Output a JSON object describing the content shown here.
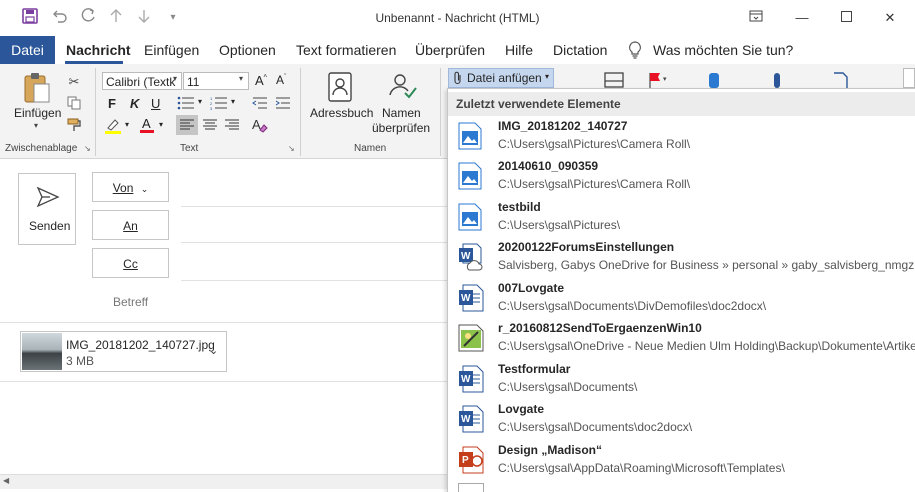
{
  "title_bar": {
    "title": "Unbenannt  -  Nachricht (HTML)",
    "save_icon": "save-icon",
    "undo_icon": "undo-icon",
    "redo_icon": "redo-icon",
    "up_icon": "up-arrow-icon",
    "down_icon": "down-arrow-icon",
    "customize_icon": "customize-icon"
  },
  "menu": {
    "datei": "Datei",
    "nachricht": "Nachricht",
    "einfuegen": "Einfügen",
    "optionen": "Optionen",
    "text_formatieren": "Text formatieren",
    "ueberpruefen": "Überprüfen",
    "hilfe": "Hilfe",
    "dictation": "Dictation",
    "tell_me": "Was möchten Sie tun?"
  },
  "ribbon": {
    "paste_label": "Einfügen",
    "clipboard_group": "Zwischenablage",
    "font_name": "Calibri (Textk",
    "font_size": "11",
    "bold": "F",
    "italic": "K",
    "underline": "U",
    "text_group": "Text",
    "address_book": "Adressbuch",
    "check_names_1": "Namen",
    "check_names_2": "überprüfen",
    "names_group": "Namen",
    "attach_file": "Datei anfügen"
  },
  "compose": {
    "send": "Senden",
    "from": "Von",
    "to": "An",
    "cc": "Cc",
    "subject_placeholder": "Betreff",
    "attachment": {
      "name": "IMG_20181202_140727.jpg",
      "size": "3 MB"
    }
  },
  "dropdown": {
    "header": "Zuletzt verwendete Elemente",
    "items": [
      {
        "name": "IMG_20181202_140727",
        "path": "C:\\Users\\gsal\\Pictures\\Camera Roll\\",
        "icon": "image-file-icon"
      },
      {
        "name": "20140610_090359",
        "path": "C:\\Users\\gsal\\Pictures\\Camera Roll\\",
        "icon": "image-file-icon"
      },
      {
        "name": "testbild",
        "path": "C:\\Users\\gsal\\Pictures\\",
        "icon": "image-file-icon"
      },
      {
        "name": "20200122ForumsEinstellungen",
        "path": "Salvisberg, Gabys OneDrive for Business » personal » gaby_salvisberg_nmgz...",
        "icon": "word-cloud-file-icon"
      },
      {
        "name": "007Lovgate",
        "path": "C:\\Users\\gsal\\Documents\\DivDemofiles\\doc2docx\\",
        "icon": "word-file-icon"
      },
      {
        "name": "r_20160812SendToErgaenzenWin10",
        "path": "C:\\Users\\gsal\\OneDrive - Neue Medien Ulm Holding\\Backup\\Dokumente\\Artikel\\",
        "icon": "image-edit-file-icon"
      },
      {
        "name": "Testformular",
        "path": "C:\\Users\\gsal\\Documents\\",
        "icon": "word-file-icon"
      },
      {
        "name": "Lovgate",
        "path": "C:\\Users\\gsal\\Documents\\doc2docx\\",
        "icon": "word-file-icon"
      },
      {
        "name": "Design „Madison“",
        "path": "C:\\Users\\gsal\\AppData\\Roaming\\Microsoft\\Templates\\",
        "icon": "powerpoint-file-icon"
      }
    ]
  },
  "colors": {
    "accent": "#2b579a",
    "highlight_yellow": "#ffff00",
    "font_red": "#e81123"
  }
}
